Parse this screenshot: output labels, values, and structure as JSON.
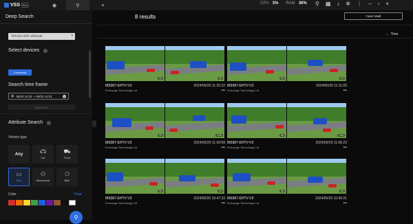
{
  "topbar": {
    "brand": "VSS",
    "badge": "Pro",
    "new_tab": "+",
    "stat1_label": "CPU",
    "stat1_value": "3%",
    "stat2_label": "RAM",
    "stat2_value": "36%",
    "icons": [
      "search-icon",
      "grid-icon",
      "bell-icon",
      "settings-icon",
      "more-icon",
      "minimize-icon",
      "maximize-icon",
      "close-icon"
    ],
    "win_min": "–",
    "win_max": "▫",
    "win_close": "×"
  },
  "sidebar": {
    "title": "Deep Search",
    "mode_select": "Vehicle with attribute",
    "select_devices_label": "Select devices",
    "devices_button": "4 cameras",
    "time_frame_label": "Search time frame",
    "time_range": "05/20 10:31 ~ 05/20 11:01",
    "reset_label": "Reset time",
    "attribute_search_label": "Attribute Search",
    "vehicle_type_label": "Vehicle type",
    "vehicle_types": [
      {
        "label": "Any",
        "icon": "",
        "selected": false
      },
      {
        "label": "Car",
        "icon": "car-icon",
        "selected": false
      },
      {
        "label": "Truck",
        "icon": "truck-icon",
        "selected": false
      },
      {
        "label": "Bus",
        "icon": "bus-icon",
        "selected": true
      },
      {
        "label": "Motorcycle",
        "icon": "motorcycle-icon",
        "selected": false
      },
      {
        "label": "Bike",
        "icon": "bike-icon",
        "selected": false
      }
    ],
    "color_label": "Color",
    "clear_label": "Clear",
    "colors": [
      "#d32f2f",
      "#ef6c00",
      "#fdd835",
      "#43a047",
      "#1e63d6",
      "#6a1b9a",
      "#8d5a2b",
      "#111111",
      "#ffffff"
    ]
  },
  "main": {
    "results": "8 results",
    "case_vault": "Case Vault",
    "sort_label": "Time",
    "cards": [
      {
        "camera": "IB9387-EHTV-V3",
        "org": "Enirosage Technology Ltd",
        "time": "2024/05/20 11:25:22",
        "badges": [
          "0s",
          "2s"
        ]
      },
      {
        "camera": "IB9387-EHTV-V3",
        "org": "Enirosage Technology Ltd",
        "time": "2024/05/20 11:11:05",
        "badges": [
          "0s",
          "2s"
        ]
      },
      {
        "camera": "IB9387-EHTV-V3",
        "org": "Enirosage Technology Ltd",
        "time": "2024/05/20 11:09:58",
        "badges": [
          "0s",
          "2.5s"
        ]
      },
      {
        "camera": "IB9387-EHTV-V3",
        "org": "Enirosage Technology Ltd",
        "time": "2024/05/20 11:06:22",
        "badges": [
          "0s",
          "2.5s"
        ]
      },
      {
        "camera": "IB9387-EHTV-V3",
        "org": "Enirosage Technology Ltd",
        "time": "2024/05/20 10:47:33",
        "badges": [
          "0s",
          "2s"
        ]
      },
      {
        "camera": "IB9387-EHTV-V3",
        "org": "Enirosage Technology Ltd",
        "time": "2024/05/20 10:40:21",
        "badges": [
          "0s",
          "2s"
        ]
      }
    ]
  }
}
